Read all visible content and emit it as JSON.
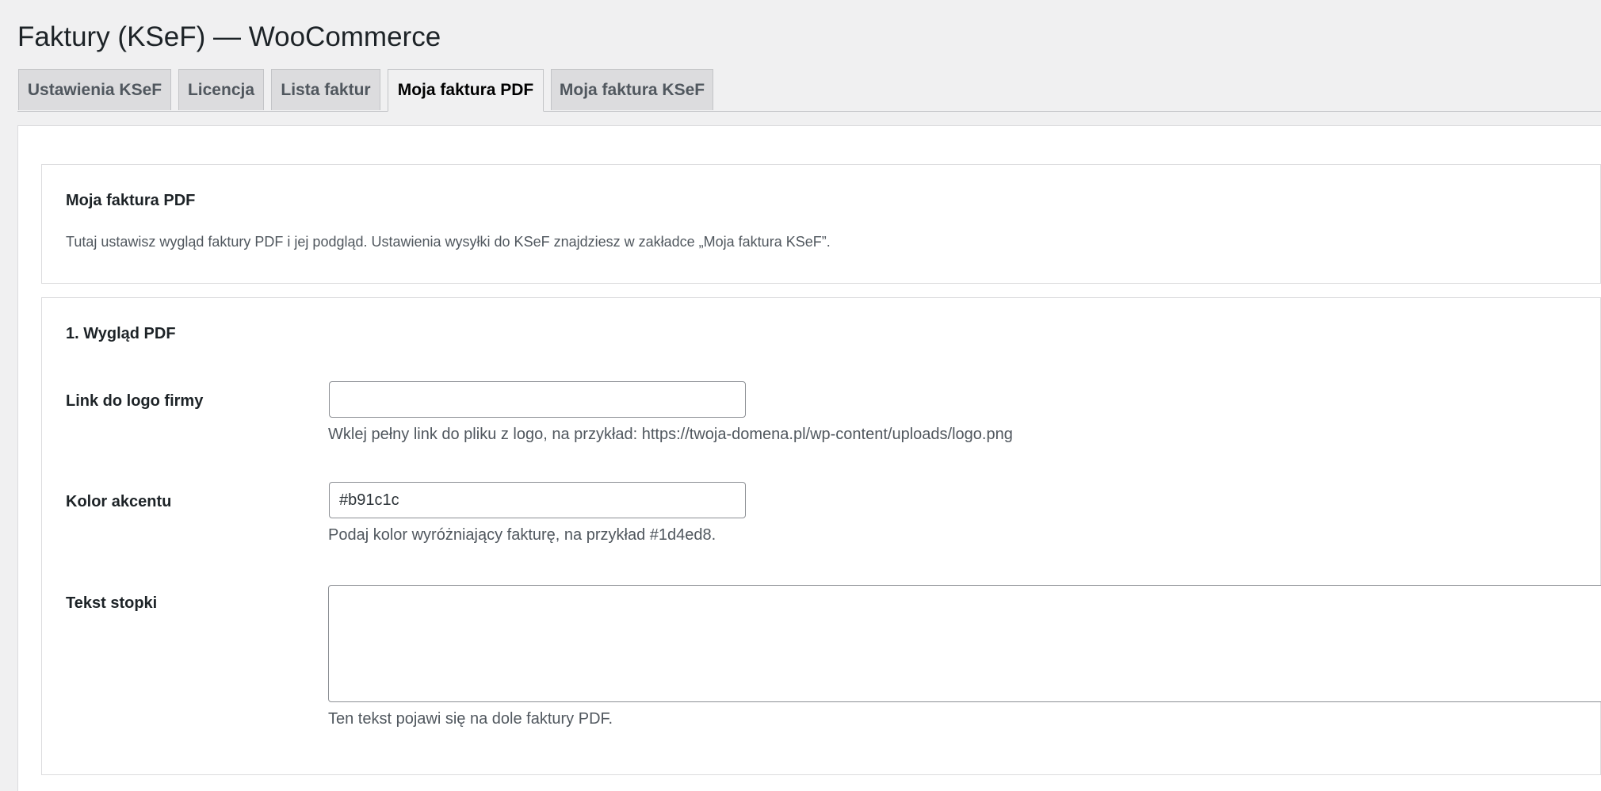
{
  "page": {
    "title": "Faktury (KSeF) — WooCommerce"
  },
  "tabs": [
    {
      "label": "Ustawienia KSeF",
      "active": false
    },
    {
      "label": "Licencja",
      "active": false
    },
    {
      "label": "Lista faktur",
      "active": false
    },
    {
      "label": "Moja faktura PDF",
      "active": true
    },
    {
      "label": "Moja faktura KSeF",
      "active": false
    }
  ],
  "intro": {
    "title": "Moja faktura PDF",
    "description": "Tutaj ustawisz wygląd faktury PDF i jej podgląd. Ustawienia wysyłki do KSeF znajdziesz w zakładce „Moja faktura KSeF”."
  },
  "appearance": {
    "title": "1. Wygląd PDF",
    "logo": {
      "label": "Link do logo firmy",
      "value": "",
      "help": "Wklej pełny link do pliku z logo, na przykład: https://twoja-domena.pl/wp-content/uploads/logo.png"
    },
    "accent": {
      "label": "Kolor akcentu",
      "value": "#b91c1c",
      "help": "Podaj kolor wyróżniający fakturę, na przykład #1d4ed8."
    },
    "footer": {
      "label": "Tekst stopki",
      "value": "",
      "help": "Ten tekst pojawi się na dole faktury PDF."
    }
  },
  "colors": {
    "background": "#f0f0f1",
    "panel": "#ffffff",
    "border": "#dcdcde",
    "tab_inactive": "#dcdcde",
    "text": "#1d2327",
    "muted_text": "#50575e"
  }
}
